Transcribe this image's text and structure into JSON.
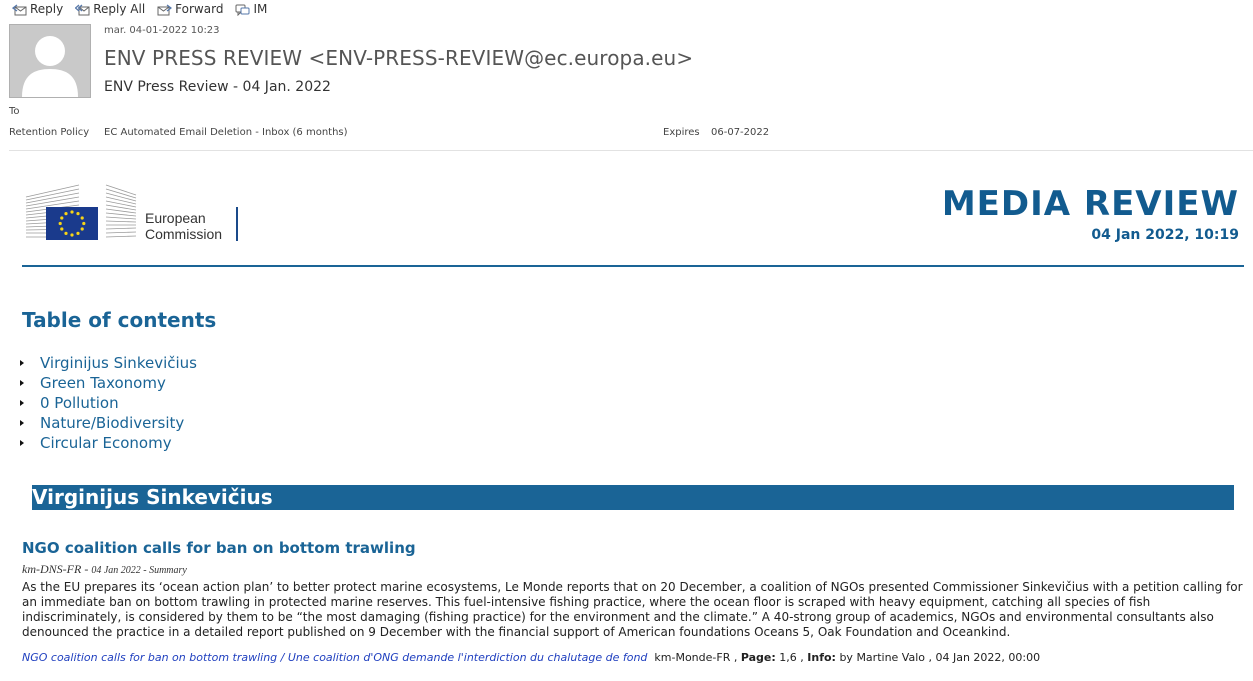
{
  "toolbar": {
    "reply": "Reply",
    "reply_all": "Reply All",
    "forward": "Forward",
    "im": "IM"
  },
  "header": {
    "date": "mar. 04-01-2022 10:23",
    "from": "ENV PRESS REVIEW <ENV-PRESS-REVIEW@ec.europa.eu>",
    "subject": "ENV Press Review - 04 Jan. 2022",
    "to_label": "To",
    "retention_label": "Retention Policy",
    "retention_value": "EC Automated Email Deletion - Inbox (6 months)",
    "expires_label": "Expires",
    "expires_value": "06-07-2022"
  },
  "logo": {
    "line1": "European",
    "line2": "Commission"
  },
  "media_review": {
    "title": "MEDIA REVIEW",
    "date": "04 Jan 2022, 10:19"
  },
  "toc": {
    "title": "Table of contents",
    "items": [
      "Virginijus Sinkevičius",
      "Green Taxonomy",
      "0 Pollution",
      "Nature/Biodiversity",
      "Circular Economy"
    ]
  },
  "section": {
    "title": "Virginijus Sinkevičius"
  },
  "article": {
    "title": "NGO coalition calls for ban on bottom trawling",
    "meta_source": "km-DNS-FR - ",
    "meta_date": "04 Jan 2022 - Summary",
    "body": "As the EU prepares its ‘ocean action plan’ to better protect marine ecosystems, Le Monde reports that on 20 December, a coalition of NGOs presented Commissioner Sinkevičius with a petition calling for an immediate ban on bottom trawling in protected marine reserves. This fuel-intensive fishing practice, where the ocean floor is scraped with heavy equipment, catching all species of fish indiscriminately, is considered by them to be “the most damaging (fishing practice) for the environment and the climate.” A 40-strong group of academics, NGOs and environmental consultants also denounced the practice in a detailed report published on 9 December with the financial support of American foundations Oceans 5, Oak Foundation and Oceankind.",
    "link_text": "NGO coalition calls for ban on bottom trawling / Une coalition d'ONG demande l'interdiction du chalutage de fond",
    "source": "km-Monde-FR",
    "page_label": "Page:",
    "page_value": "1,6",
    "info_label": "Info:",
    "info_value": "by Martine Valo ,  04 Jan 2022, 00:00"
  },
  "colors": {
    "accent": "#1a6496",
    "title_blue": "#125b8f",
    "link": "#1f3fbf"
  },
  "icons": {
    "reply": "reply-icon",
    "reply_all": "reply-all-icon",
    "forward": "forward-icon",
    "im": "im-icon"
  }
}
